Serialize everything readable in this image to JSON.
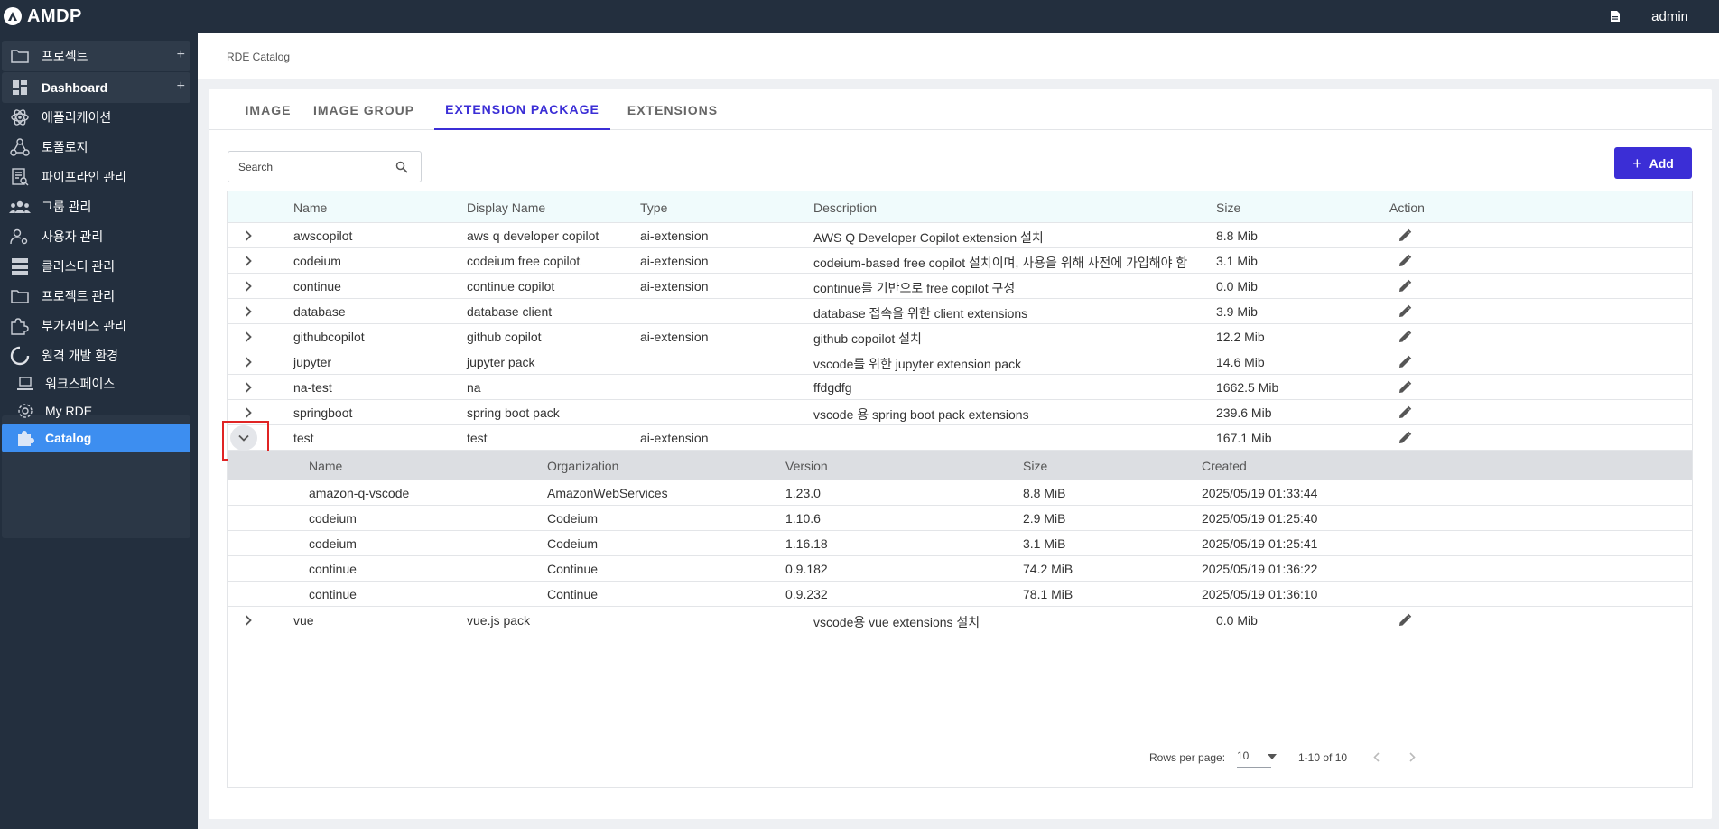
{
  "app": {
    "name": "AMDP",
    "user": "admin"
  },
  "sidebar": {
    "items": [
      {
        "label": "프로젝트",
        "plus": "+"
      },
      {
        "label": "Dashboard",
        "plus": "+"
      },
      {
        "label": "애플리케이션"
      },
      {
        "label": "토폴로지"
      },
      {
        "label": "파이프라인 관리"
      },
      {
        "label": "그룹 관리"
      },
      {
        "label": "사용자 관리"
      },
      {
        "label": "클러스터 관리"
      },
      {
        "label": "프로젝트 관리"
      },
      {
        "label": "부가서비스 관리"
      },
      {
        "label": "원격 개발 환경"
      },
      {
        "label": "워크스페이스"
      },
      {
        "label": "My RDE"
      },
      {
        "label": "Catalog"
      }
    ]
  },
  "breadcrumb": "RDE Catalog",
  "tabs": [
    "IMAGE",
    "IMAGE GROUP",
    "EXTENSION PACKAGE",
    "EXTENSIONS"
  ],
  "active_tab": "EXTENSION PACKAGE",
  "search": {
    "placeholder": "Search"
  },
  "add_button": {
    "label": "Add"
  },
  "table": {
    "headers": [
      "Name",
      "Display Name",
      "Type",
      "Description",
      "Size",
      "Action"
    ],
    "rows": [
      {
        "name": "awscopilot",
        "display": "aws q developer copilot",
        "type": "ai-extension",
        "desc": "AWS Q Developer Copilot extension 설치",
        "size": "8.8 Mib"
      },
      {
        "name": "codeium",
        "display": "codeium free copilot",
        "type": "ai-extension",
        "desc": "codeium-based free copilot 설치이며, 사용을 위해 사전에 가입해야 함",
        "size": "3.1 Mib"
      },
      {
        "name": "continue",
        "display": "continue copilot",
        "type": "ai-extension",
        "desc": "continue를 기반으로 free copilot 구성",
        "size": "0.0 Mib"
      },
      {
        "name": "database",
        "display": "database client",
        "type": "",
        "desc": "database 접속을 위한 client extensions",
        "size": "3.9 Mib"
      },
      {
        "name": "githubcopilot",
        "display": "github copilot",
        "type": "ai-extension",
        "desc": "github copoilot 설치",
        "size": "12.2 Mib"
      },
      {
        "name": "jupyter",
        "display": "jupyter pack",
        "type": "",
        "desc": "vscode를 위한 jupyter extension pack",
        "size": "14.6 Mib"
      },
      {
        "name": "na-test",
        "display": "na",
        "type": "",
        "desc": "ffdgdfg",
        "size": "1662.5 Mib"
      },
      {
        "name": "springboot",
        "display": "spring boot pack",
        "type": "",
        "desc": "vscode 용 spring boot pack extensions",
        "size": "239.6 Mib"
      },
      {
        "name": "test",
        "display": "test",
        "type": "ai-extension",
        "desc": "",
        "size": "167.1 Mib"
      },
      {
        "name": "vue",
        "display": "vue.js pack",
        "type": "",
        "desc": "vscode용 vue extensions 설치",
        "size": "0.0 Mib"
      }
    ]
  },
  "subtable": {
    "headers": [
      "Name",
      "Organization",
      "Version",
      "Size",
      "Created"
    ],
    "rows": [
      {
        "name": "amazon-q-vscode",
        "org": "AmazonWebServices",
        "version": "1.23.0",
        "size": "8.8 MiB",
        "created": "2025/05/19 01:33:44"
      },
      {
        "name": "codeium",
        "org": "Codeium",
        "version": "1.10.6",
        "size": "2.9 MiB",
        "created": "2025/05/19 01:25:40"
      },
      {
        "name": "codeium",
        "org": "Codeium",
        "version": "1.16.18",
        "size": "3.1 MiB",
        "created": "2025/05/19 01:25:41"
      },
      {
        "name": "continue",
        "org": "Continue",
        "version": "0.9.182",
        "size": "74.2 MiB",
        "created": "2025/05/19 01:36:22"
      },
      {
        "name": "continue",
        "org": "Continue",
        "version": "0.9.232",
        "size": "78.1 MiB",
        "created": "2025/05/19 01:36:10"
      }
    ]
  },
  "pagination": {
    "rows_per_page_label": "Rows per page:",
    "rows_per_page": "10",
    "range": "1-10 of 10"
  },
  "colors": {
    "accent": "#3b2ed6",
    "sidebar_bg": "#232f3e",
    "active_nav": "#3d8ef0",
    "highlight_box": "#e02424"
  }
}
